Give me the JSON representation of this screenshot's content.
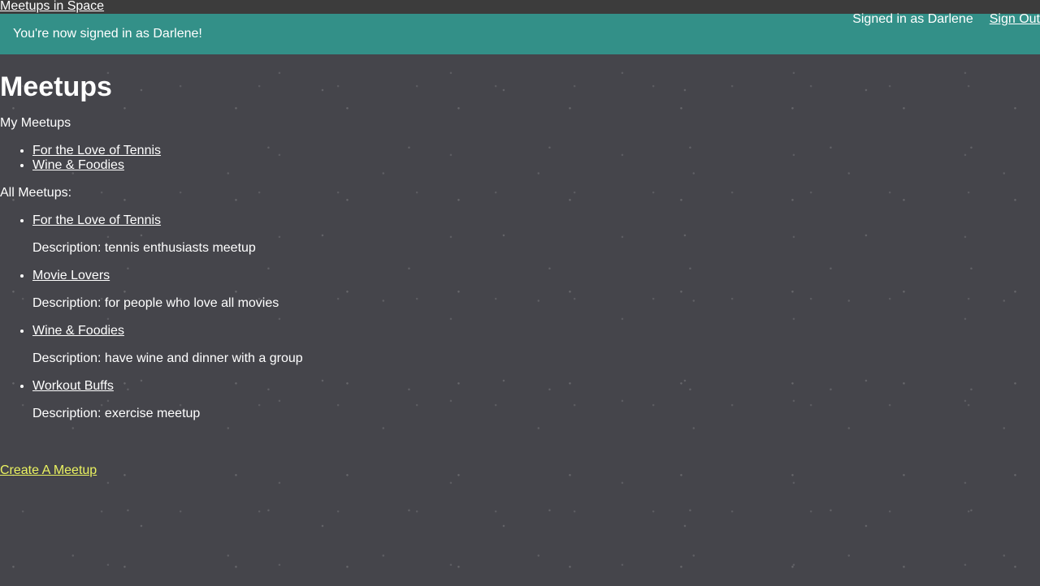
{
  "header": {
    "site_title": "Meetups in Space",
    "signed_in_text": "Signed in as Darlene",
    "sign_out_label": "Sign Out"
  },
  "flash": {
    "message": "You're now signed in as Darlene!"
  },
  "main": {
    "title": "Meetups",
    "my_meetups_label": "My Meetups",
    "my_meetups": [
      "For the Love of Tennis",
      "Wine & Foodies"
    ],
    "all_meetups_label": "All Meetups:",
    "all_meetups": [
      {
        "name": "For the Love of Tennis",
        "description": "Description: tennis enthusiasts meetup"
      },
      {
        "name": "Movie Lovers",
        "description": "Description: for people who love all movies"
      },
      {
        "name": "Wine & Foodies",
        "description": "Description: have wine and dinner with a group"
      },
      {
        "name": "Workout Buffs",
        "description": "Description: exercise meetup"
      }
    ],
    "create_label": "Create A Meetup"
  },
  "colors": {
    "background": "#45454b",
    "topbar": "#3c3c3c",
    "flash": "#339088",
    "create_link": "#eaf260"
  }
}
